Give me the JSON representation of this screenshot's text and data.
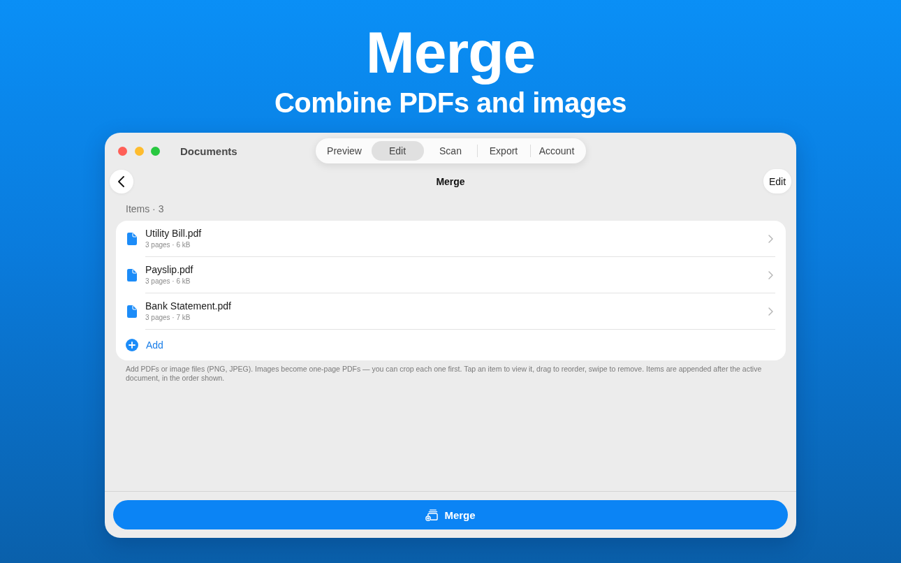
{
  "headline": {
    "title": "Merge",
    "subtitle": "Combine PDFs and images"
  },
  "window": {
    "title": "Documents",
    "tabs": [
      {
        "label": "Preview",
        "selected": false
      },
      {
        "label": "Edit",
        "selected": true
      },
      {
        "label": "Scan",
        "selected": false
      },
      {
        "label": "Export",
        "selected": false
      },
      {
        "label": "Account",
        "selected": false
      }
    ]
  },
  "nav": {
    "title": "Merge",
    "edit_button": "Edit"
  },
  "section": {
    "header": "Items · 3",
    "items": [
      {
        "name": "Utility Bill.pdf",
        "details": "3 pages · 6 kB"
      },
      {
        "name": "Payslip.pdf",
        "details": "3 pages · 6 kB"
      },
      {
        "name": "Bank Statement.pdf",
        "details": "3 pages · 7 kB"
      }
    ],
    "add_label": "Add",
    "footer": "Add PDFs or image files (PNG, JPEG). Images become one-page PDFs — you can crop each one first. Tap an item to view it, drag to reorder, swipe to remove. Items are appended after the active document, in the order shown."
  },
  "merge_button": {
    "label": "Merge"
  }
}
